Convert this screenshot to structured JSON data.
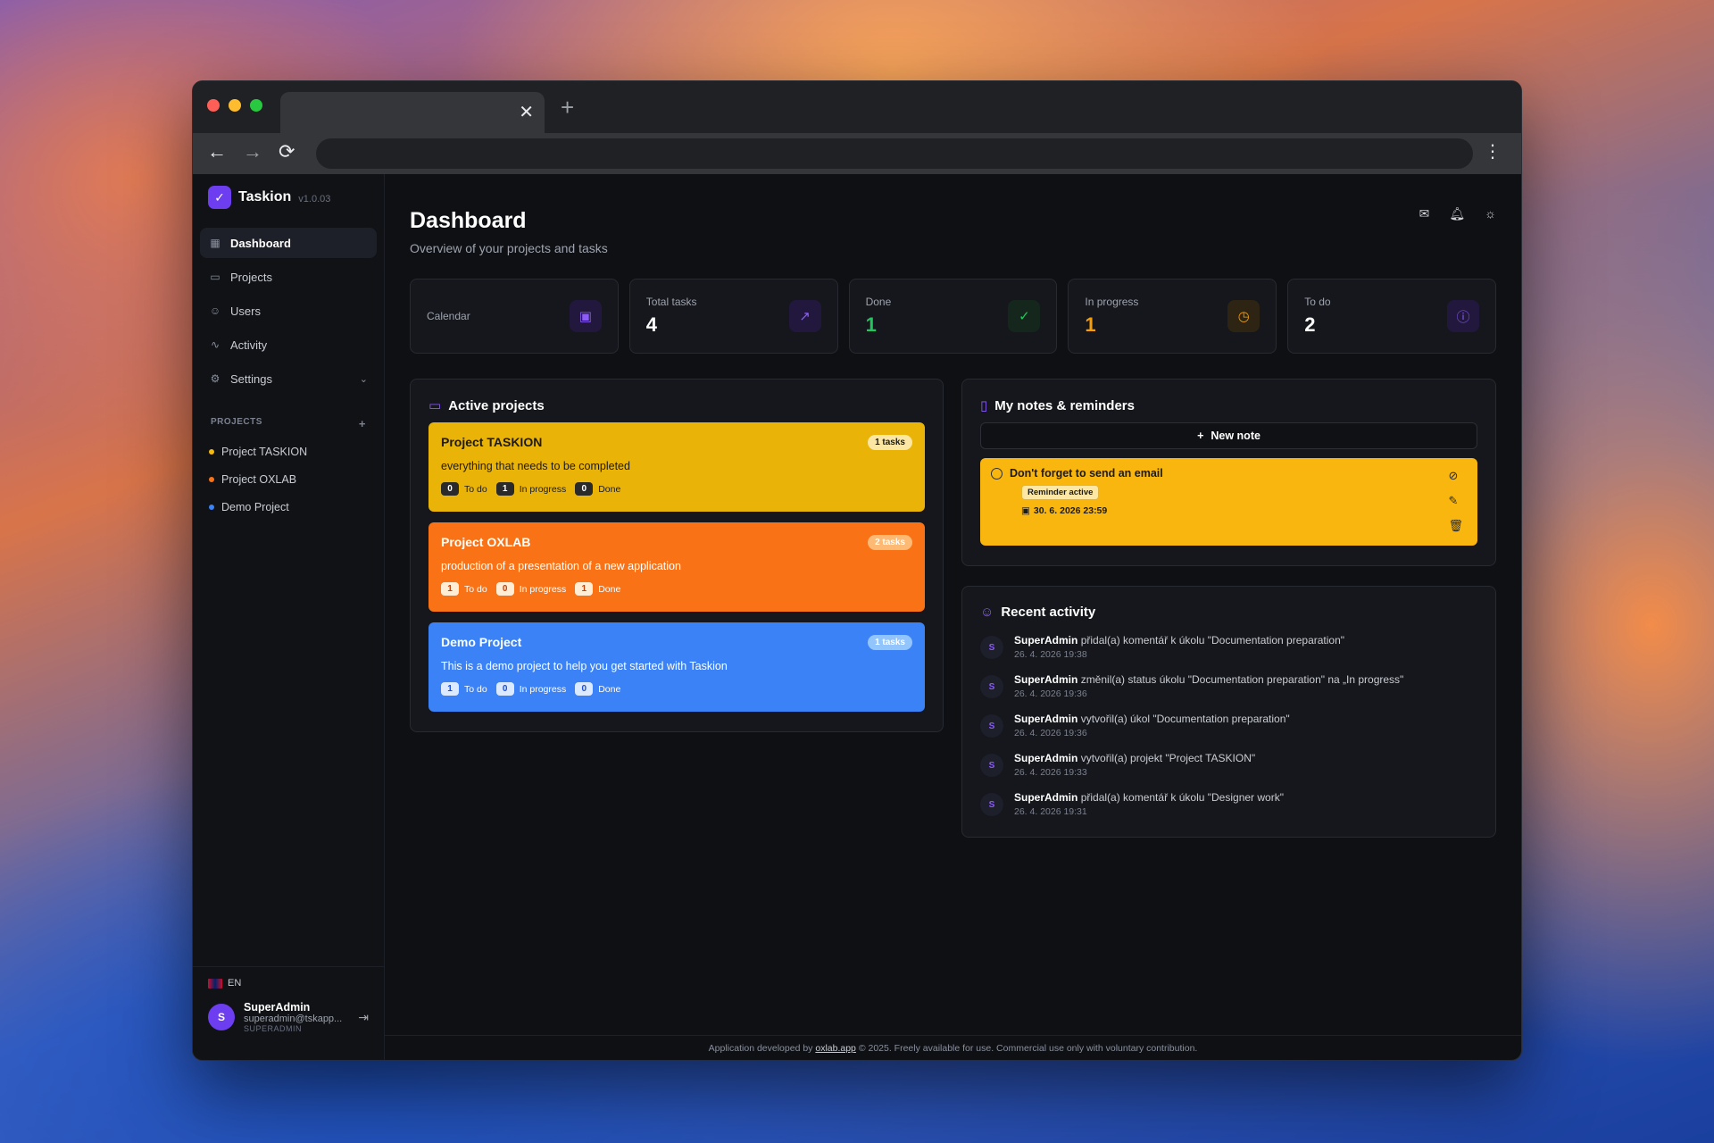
{
  "browser": {
    "tab_close": "✕",
    "new_tab": "+",
    "back": "←",
    "forward": "→",
    "reload": "⟳",
    "menu": "⋮"
  },
  "brand": {
    "name": "Taskion",
    "version": "v1.0.03"
  },
  "sidebar": {
    "items": [
      {
        "label": "Dashboard",
        "icon": "dashboard-icon"
      },
      {
        "label": "Projects",
        "icon": "folder-icon"
      },
      {
        "label": "Users",
        "icon": "users-icon"
      },
      {
        "label": "Activity",
        "icon": "activity-icon"
      },
      {
        "label": "Settings",
        "icon": "gear-icon"
      }
    ],
    "projects_heading": "PROJECTS",
    "projects": [
      {
        "label": "Project TASKION",
        "color": "#f5b90f"
      },
      {
        "label": "Project OXLAB",
        "color": "#f97316"
      },
      {
        "label": "Demo Project",
        "color": "#3b82f6"
      }
    ],
    "lang": "EN",
    "user": {
      "initial": "S",
      "name": "SuperAdmin",
      "email": "superadmin@tskapp...",
      "role": "SUPERADMIN"
    }
  },
  "header": {
    "title": "Dashboard",
    "subtitle": "Overview of your projects and tasks"
  },
  "stats": [
    {
      "label": "Calendar",
      "value": "",
      "icon": "calendar-icon",
      "color": "#8b5cf6"
    },
    {
      "label": "Total tasks",
      "value": "4",
      "icon": "trending-up-icon",
      "color": "#8b5cf6"
    },
    {
      "label": "Done",
      "value": "1",
      "icon": "check-circle-icon",
      "color": "#22c55e"
    },
    {
      "label": "In progress",
      "value": "1",
      "icon": "clock-icon",
      "color": "#f59e0b"
    },
    {
      "label": "To do",
      "value": "2",
      "icon": "alert-circle-icon",
      "color": "#8b5cf6"
    }
  ],
  "projects_panel": {
    "title": "Active projects",
    "todo_label": "To do",
    "inprogress_label": "In progress",
    "done_label": "Done",
    "projects": [
      {
        "name": "Project TASKION",
        "tasks": "1 tasks",
        "desc": "everything that needs to be completed",
        "todo": "0",
        "inprogress": "1",
        "done": "0",
        "color": "#eab308"
      },
      {
        "name": "Project OXLAB",
        "tasks": "2 tasks",
        "desc": "production of a presentation of a new application",
        "todo": "1",
        "inprogress": "0",
        "done": "1",
        "color": "#f97316"
      },
      {
        "name": "Demo Project",
        "tasks": "1 tasks",
        "desc": "This is a demo project to help you get started with Taskion",
        "todo": "1",
        "inprogress": "0",
        "done": "0",
        "color": "#3b82f6"
      }
    ]
  },
  "notes_panel": {
    "title": "My notes & reminders",
    "new_note": "New note",
    "note": {
      "title": "Don't forget to send an email",
      "badge": "Reminder active",
      "date": "30. 6. 2026 23:59"
    }
  },
  "activity_panel": {
    "title": "Recent activity",
    "items": [
      {
        "initial": "S",
        "user": "SuperAdmin",
        "text": "přidal(a) komentář k úkolu \"Documentation preparation\"",
        "time": "26. 4. 2026 19:38"
      },
      {
        "initial": "S",
        "user": "SuperAdmin",
        "text": "změnil(a) status úkolu \"Documentation preparation\" na „In progress\"",
        "time": "26. 4. 2026 19:36"
      },
      {
        "initial": "S",
        "user": "SuperAdmin",
        "text": "vytvořil(a) úkol \"Documentation preparation\"",
        "time": "26. 4. 2026 19:36"
      },
      {
        "initial": "S",
        "user": "SuperAdmin",
        "text": "vytvořil(a) projekt \"Project TASKION\"",
        "time": "26. 4. 2026 19:33"
      },
      {
        "initial": "S",
        "user": "SuperAdmin",
        "text": "přidal(a) komentář k úkolu \"Designer work\"",
        "time": "26. 4. 2026 19:31"
      }
    ]
  },
  "footer": {
    "prefix": "Application developed by",
    "link": "oxlab.app",
    "suffix": "© 2025. Freely available for use. Commercial use only with voluntary contribution."
  }
}
